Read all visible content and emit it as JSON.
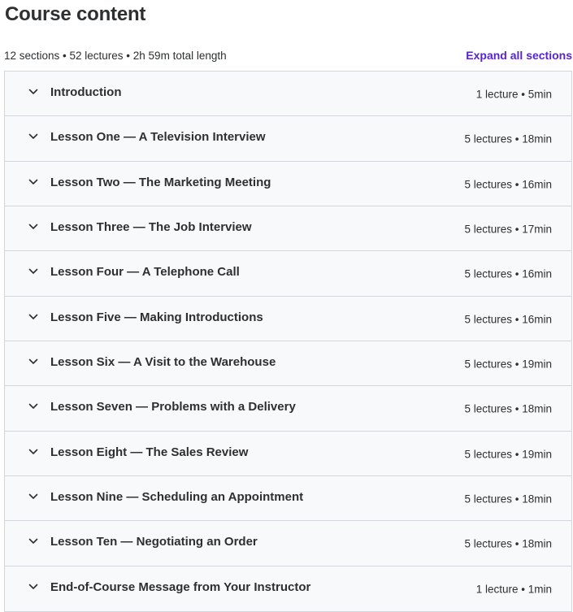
{
  "header": {
    "title": "Course content",
    "stats": "12 sections • 52 lectures • 2h 59m total length",
    "expand_label": "Expand all sections"
  },
  "icons": {
    "section_toggle": "chevron-down-icon"
  },
  "colors": {
    "accent": "#5624d0",
    "section_bg": "#f7f9fa",
    "border": "#d1d7dc",
    "text": "#2d2f31"
  },
  "sections": [
    {
      "title": "Introduction",
      "meta": "1 lecture • 5min"
    },
    {
      "title": "Lesson One — A Television Interview",
      "meta": "5 lectures • 18min"
    },
    {
      "title": "Lesson Two — The Marketing Meeting",
      "meta": "5 lectures • 16min"
    },
    {
      "title": "Lesson Three — The Job Interview",
      "meta": "5 lectures • 17min"
    },
    {
      "title": "Lesson Four — A Telephone Call",
      "meta": "5 lectures • 16min"
    },
    {
      "title": "Lesson Five — Making Introductions",
      "meta": "5 lectures • 16min"
    },
    {
      "title": "Lesson Six — A Visit to the Warehouse",
      "meta": "5 lectures • 19min"
    },
    {
      "title": "Lesson Seven — Problems with a Delivery",
      "meta": "5 lectures • 18min"
    },
    {
      "title": "Lesson Eight — The Sales Review",
      "meta": "5 lectures • 19min"
    },
    {
      "title": "Lesson Nine — Scheduling an Appointment",
      "meta": "5 lectures • 18min"
    },
    {
      "title": "Lesson Ten — Negotiating an Order",
      "meta": "5 lectures • 18min"
    },
    {
      "title": "End-of-Course Message from Your Instructor",
      "meta": "1 lecture • 1min"
    }
  ]
}
